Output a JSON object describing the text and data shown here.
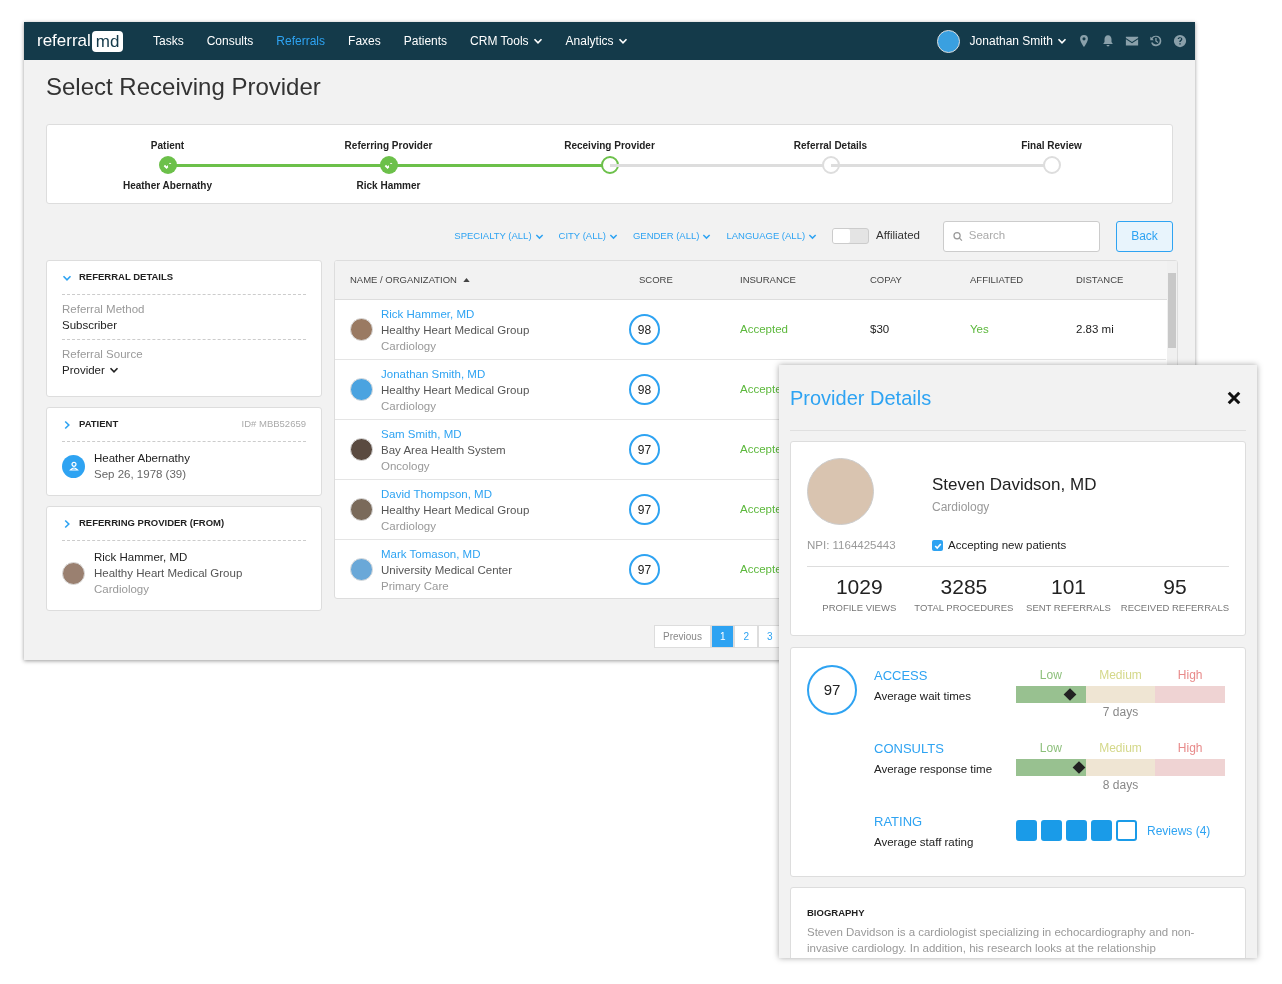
{
  "logo": {
    "text": "referral",
    "badge": "md"
  },
  "nav": [
    {
      "label": "Tasks",
      "selected": false,
      "dropdown": false
    },
    {
      "label": "Consults",
      "selected": false,
      "dropdown": false
    },
    {
      "label": "Referrals",
      "selected": true,
      "dropdown": false
    },
    {
      "label": "Faxes",
      "selected": false,
      "dropdown": false
    },
    {
      "label": "Patients",
      "selected": false,
      "dropdown": false
    },
    {
      "label": "CRM Tools",
      "selected": false,
      "dropdown": true
    },
    {
      "label": "Analytics",
      "selected": false,
      "dropdown": true
    }
  ],
  "user": {
    "name": "Jonathan Smith"
  },
  "page_title": "Select Receiving Provider",
  "steps": [
    {
      "label": "Patient",
      "value": "Heather Abernathy",
      "completed": true,
      "selected": false
    },
    {
      "label": "Referring Provider",
      "value": "Rick Hammer",
      "completed": true,
      "selected": false
    },
    {
      "label": "Receiving Provider",
      "completed": false,
      "selected": true
    },
    {
      "label": "Referral Details",
      "completed": false,
      "selected": false
    },
    {
      "label": "Final Review",
      "completed": false,
      "selected": false
    }
  ],
  "filters": [
    "SPECIALTY (ALL)",
    "CITY (ALL)",
    "GENDER (ALL)",
    "LANGUAGE (ALL)"
  ],
  "affiliated_toggle": {
    "label": "Affiliated",
    "on": false
  },
  "search": {
    "placeholder": "Search"
  },
  "back_button": "Back",
  "referral_details": {
    "title": "REFERRAL DETAILS",
    "expanded": true,
    "fields": [
      {
        "label": "Referral Method",
        "value": "Subscriber",
        "dropdown": false
      },
      {
        "label": "Referral Source",
        "value": "Provider",
        "dropdown": true
      }
    ]
  },
  "patient": {
    "title": "PATIENT",
    "expanded": false,
    "id": "ID# MBB52659",
    "name": "Heather Abernathy",
    "dob": "Sep 26, 1978 (39)"
  },
  "referring_provider": {
    "title": "REFERRING PROVIDER (FROM)",
    "expanded": false,
    "name": "Rick Hammer, MD",
    "org": "Healthy Heart Medical Group",
    "specialty": "Cardiology"
  },
  "table": {
    "columns": [
      "NAME / ORGANIZATION",
      "SCORE",
      "INSURANCE",
      "COPAY",
      "AFFILIATED",
      "DISTANCE"
    ],
    "rows": [
      {
        "name": "Rick Hammer, MD",
        "org": "Healthy Heart Medical Group",
        "specialty": "Cardiology",
        "score": "98",
        "insurance": "Accepted",
        "copay": "$30",
        "affiliated": "Yes",
        "distance": "2.83 mi"
      },
      {
        "name": "Jonathan Smith, MD",
        "org": "Healthy Heart Medical Group",
        "specialty": "Cardiology",
        "score": "98",
        "insurance": "Accepte"
      },
      {
        "name": "Sam Smith, MD",
        "org": "Bay Area Health System",
        "specialty": "Oncology",
        "score": "97",
        "insurance": "Accepte"
      },
      {
        "name": "David Thompson, MD",
        "org": "Healthy Heart Medical Group",
        "specialty": "Cardiology",
        "score": "97",
        "insurance": "Accepte"
      },
      {
        "name": "Mark Tomason, MD",
        "org": "University Medical Center",
        "specialty": "Primary Care",
        "score": "97",
        "insurance": "Accepte"
      }
    ]
  },
  "pagination": [
    {
      "label": "Previous",
      "selected": false
    },
    {
      "label": "1",
      "selected": true
    },
    {
      "label": "2",
      "selected": false
    },
    {
      "label": "3",
      "selected": false
    }
  ],
  "provider_details": {
    "title": "Provider Details",
    "name": "Steven Davidson, MD",
    "specialty": "Cardiology",
    "npi": "NPI: 1164425443",
    "accepting": {
      "label": "Accepting new patients",
      "checked": true
    },
    "stats": [
      {
        "value": "1029",
        "label": "PROFILE VIEWS"
      },
      {
        "value": "3285",
        "label": "TOTAL PROCEDURES"
      },
      {
        "value": "101",
        "label": "SENT REFERRALS"
      },
      {
        "value": "95",
        "label": "RECEIVED REFERRALS"
      }
    ],
    "score": "97",
    "metrics": [
      {
        "kind": "scale",
        "title": "ACCESS",
        "subtitle": "Average wait times",
        "scale": [
          "Low",
          "Medium",
          "High"
        ],
        "level": 0.26,
        "reading": "7 days"
      },
      {
        "kind": "scale",
        "title": "CONSULTS",
        "subtitle": "Average response time",
        "scale": [
          "Low",
          "Medium",
          "High"
        ],
        "level": 0.3,
        "reading": "8 days"
      },
      {
        "kind": "stars",
        "title": "RATING",
        "subtitle": "Average staff rating",
        "stars": 4,
        "link": "Reviews (4)"
      }
    ],
    "biography": {
      "title": "BIOGRAPHY",
      "text": "Steven Davidson is a cardiologist specializing in echocardiography and non-invasive cardiology. In addition, his research looks at the relationship"
    }
  }
}
